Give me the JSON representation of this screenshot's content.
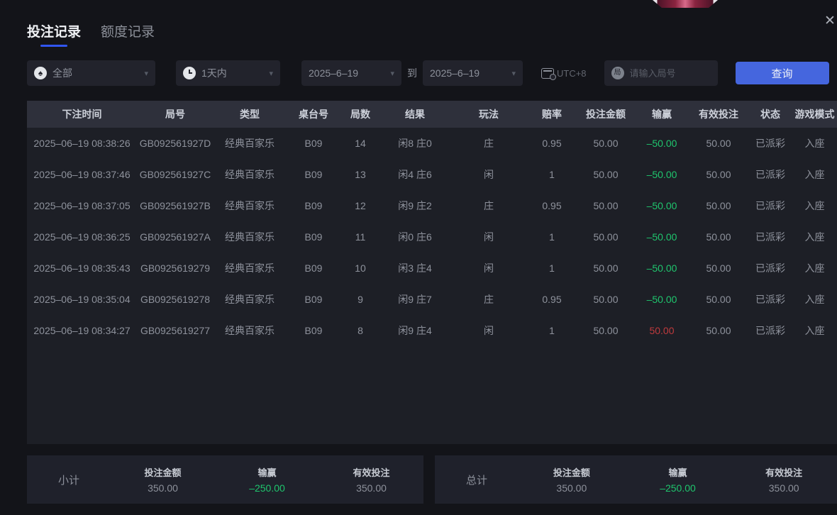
{
  "tabs": {
    "bet_records": "投注记录",
    "quota_records": "额度记录"
  },
  "icons": {
    "close": "✕",
    "chevron_down": "▾",
    "spade": "♠",
    "round_badge": "局"
  },
  "filters": {
    "game_type_value": "全部",
    "time_range_value": "1天内",
    "date_from": "2025–6–19",
    "to_label": "到",
    "date_to": "2025–6–19",
    "timezone": "UTC+8",
    "round_input_placeholder": "请输入局号",
    "query_button": "查询"
  },
  "table": {
    "headers": [
      "下注时间",
      "局号",
      "类型",
      "桌台号",
      "局数",
      "结果",
      "玩法",
      "赔率",
      "投注金额",
      "输赢",
      "有效投注",
      "状态",
      "游戏模式"
    ],
    "rows": [
      {
        "time": "2025–06–19 08:38:26",
        "round": "GB092561927D",
        "type": "经典百家乐",
        "table_no": "B09",
        "games": "14",
        "result": "闲8 庄0",
        "play": "庄",
        "odds": "0.95",
        "amount": "50.00",
        "winloss": "–50.00",
        "valid": "50.00",
        "status": "已派彩",
        "mode": "入座"
      },
      {
        "time": "2025–06–19 08:37:46",
        "round": "GB092561927C",
        "type": "经典百家乐",
        "table_no": "B09",
        "games": "13",
        "result": "闲4 庄6",
        "play": "闲",
        "odds": "1",
        "amount": "50.00",
        "winloss": "–50.00",
        "valid": "50.00",
        "status": "已派彩",
        "mode": "入座"
      },
      {
        "time": "2025–06–19 08:37:05",
        "round": "GB092561927B",
        "type": "经典百家乐",
        "table_no": "B09",
        "games": "12",
        "result": "闲9 庄2",
        "play": "庄",
        "odds": "0.95",
        "amount": "50.00",
        "winloss": "–50.00",
        "valid": "50.00",
        "status": "已派彩",
        "mode": "入座"
      },
      {
        "time": "2025–06–19 08:36:25",
        "round": "GB092561927A",
        "type": "经典百家乐",
        "table_no": "B09",
        "games": "11",
        "result": "闲0 庄6",
        "play": "闲",
        "odds": "1",
        "amount": "50.00",
        "winloss": "–50.00",
        "valid": "50.00",
        "status": "已派彩",
        "mode": "入座"
      },
      {
        "time": "2025–06–19 08:35:43",
        "round": "GB0925619279",
        "type": "经典百家乐",
        "table_no": "B09",
        "games": "10",
        "result": "闲3 庄4",
        "play": "闲",
        "odds": "1",
        "amount": "50.00",
        "winloss": "–50.00",
        "valid": "50.00",
        "status": "已派彩",
        "mode": "入座"
      },
      {
        "time": "2025–06–19 08:35:04",
        "round": "GB0925619278",
        "type": "经典百家乐",
        "table_no": "B09",
        "games": "9",
        "result": "闲9 庄7",
        "play": "庄",
        "odds": "0.95",
        "amount": "50.00",
        "winloss": "–50.00",
        "valid": "50.00",
        "status": "已派彩",
        "mode": "入座"
      },
      {
        "time": "2025–06–19 08:34:27",
        "round": "GB0925619277",
        "type": "经典百家乐",
        "table_no": "B09",
        "games": "8",
        "result": "闲9 庄4",
        "play": "闲",
        "odds": "1",
        "amount": "50.00",
        "winloss": "50.00",
        "valid": "50.00",
        "status": "已派彩",
        "mode": "入座"
      }
    ]
  },
  "summary": {
    "subtotal": {
      "label": "小计",
      "amount_title": "投注金额",
      "amount": "350.00",
      "winloss_title": "输赢",
      "winloss": "–250.00",
      "valid_title": "有效投注",
      "valid": "350.00"
    },
    "total": {
      "label": "总计",
      "amount_title": "投注金额",
      "amount": "350.00",
      "winloss_title": "输赢",
      "winloss": "–250.00",
      "valid_title": "有效投注",
      "valid": "350.00"
    }
  },
  "colors": {
    "accent_blue": "#4566de",
    "tab_underline": "#3156f0",
    "green": "#1fc56d",
    "red": "#bf3a3d"
  }
}
